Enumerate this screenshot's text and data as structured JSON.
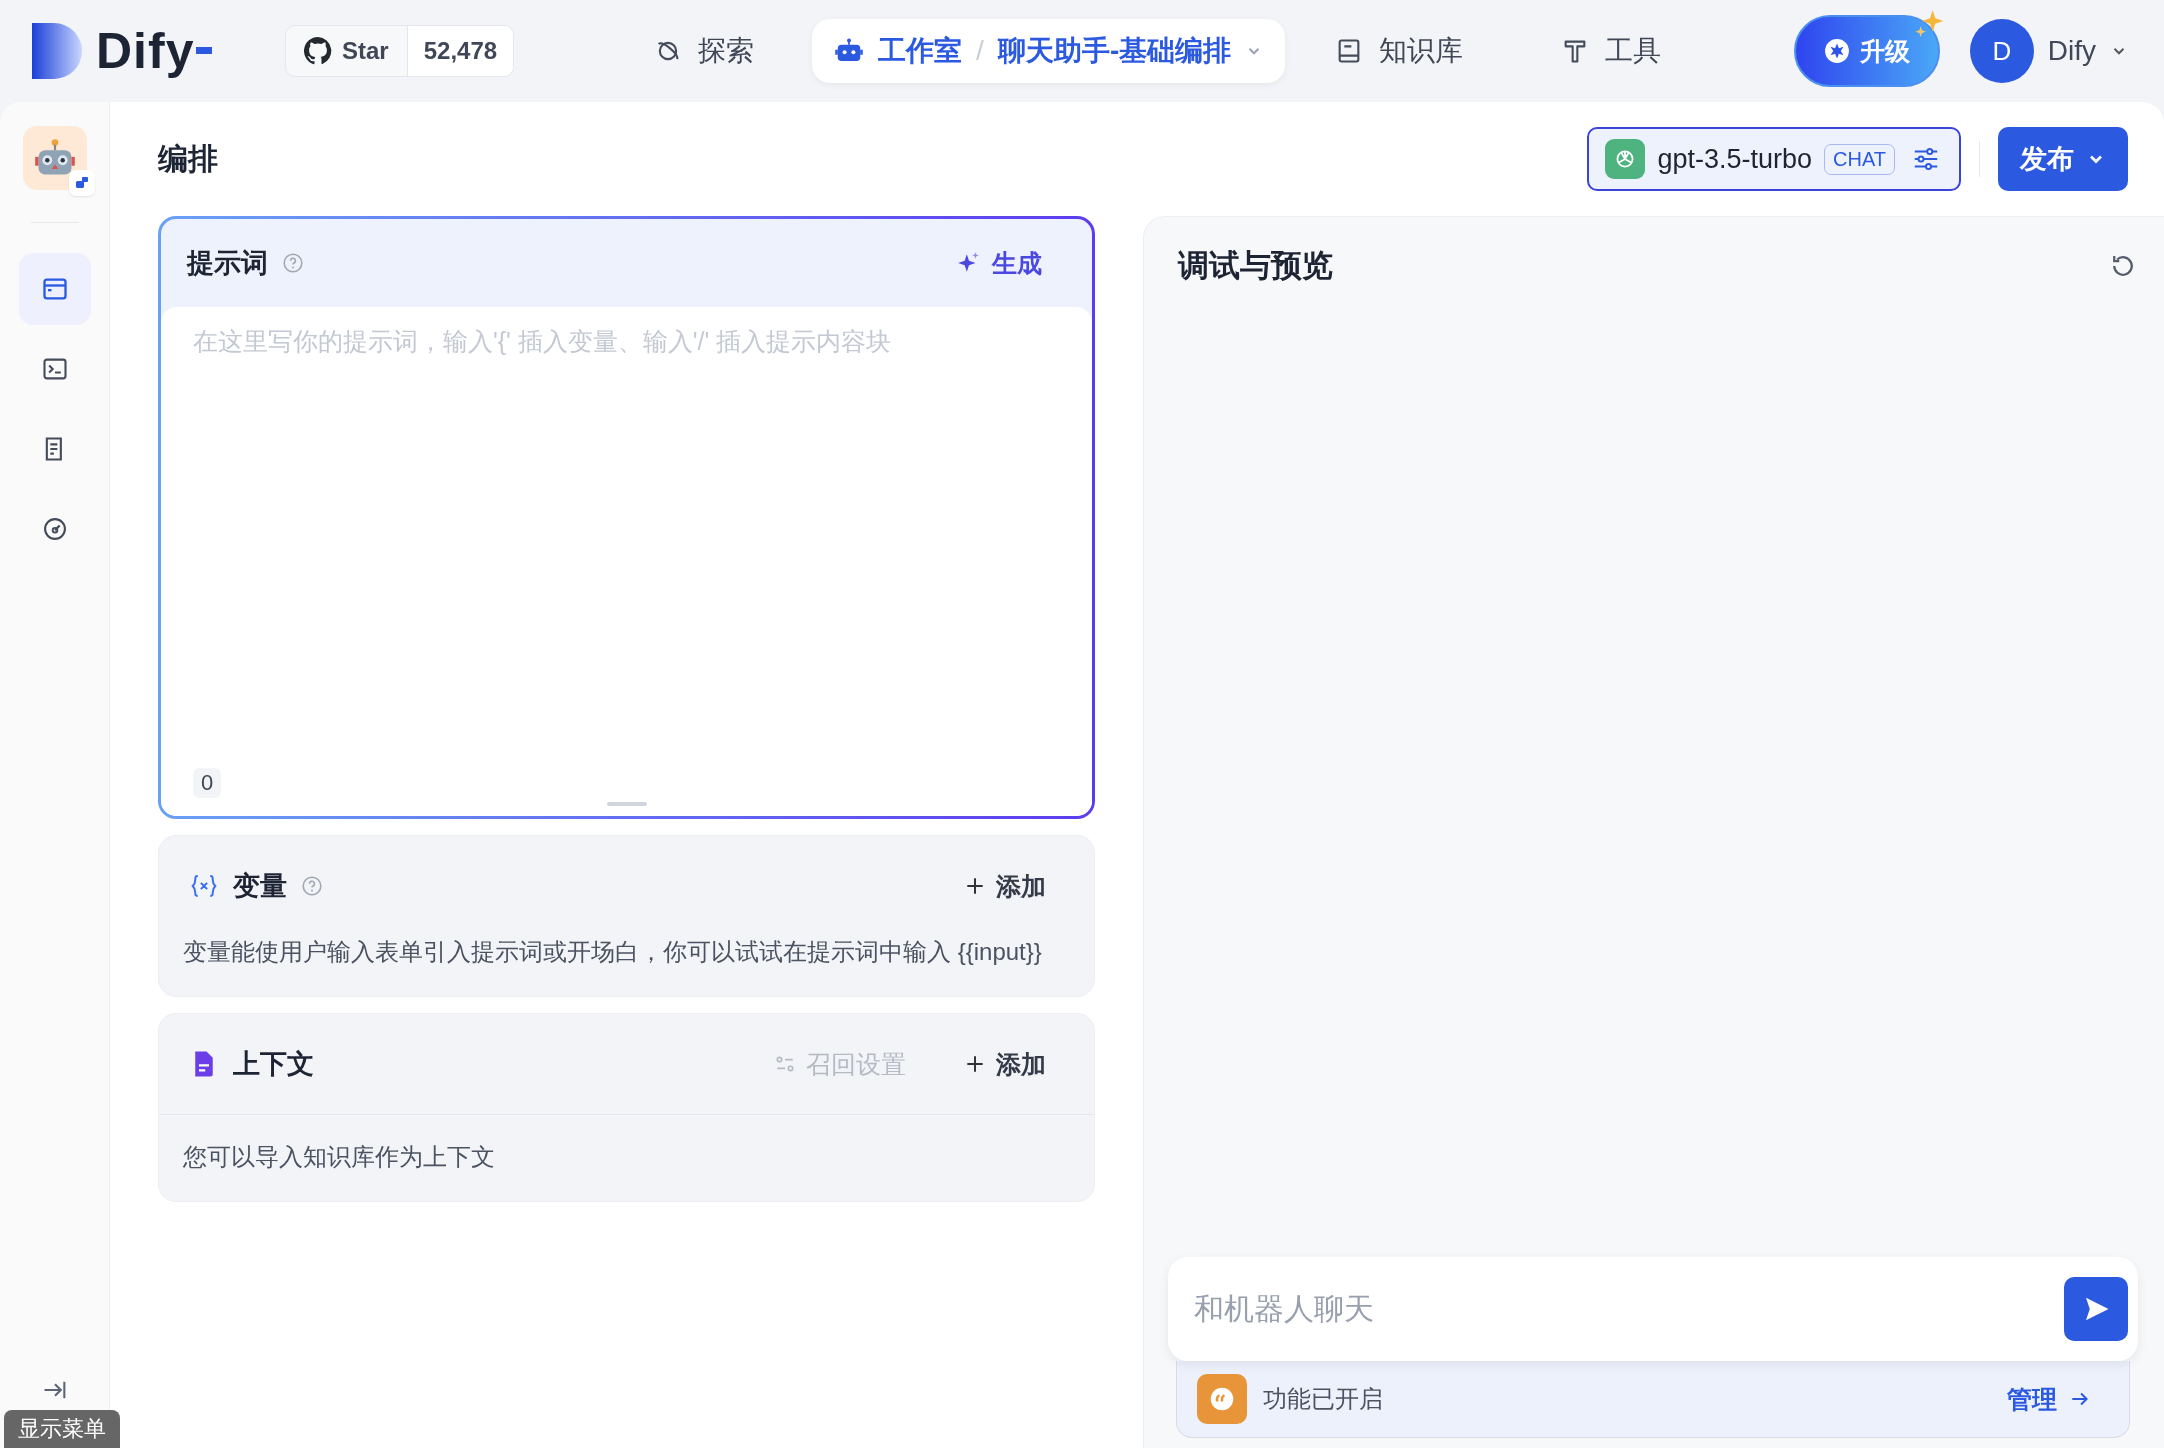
{
  "topbar": {
    "brand": "Dify",
    "github": {
      "label": "Star",
      "count": "52,478"
    },
    "nav": [
      {
        "kind": "explore",
        "label": "探索",
        "selected": false
      },
      {
        "kind": "studio",
        "label": "工作室",
        "separator": "/",
        "app": "聊天助手-基础编排",
        "selected": true
      },
      {
        "kind": "datasets",
        "label": "知识库",
        "selected": false
      },
      {
        "kind": "tools",
        "label": "工具",
        "selected": false
      }
    ],
    "upgrade": "升级",
    "user": {
      "initial": "D",
      "name": "Dify"
    }
  },
  "sidebar": {
    "items": [
      {
        "kind": "orchestrate",
        "selected": true
      },
      {
        "kind": "api",
        "selected": false
      },
      {
        "kind": "logs",
        "selected": false
      },
      {
        "kind": "monitor",
        "selected": false
      }
    ],
    "tooltip": "显示菜单"
  },
  "header": {
    "title": "编排",
    "model": {
      "name": "gpt-3.5-turbo",
      "mode": "CHAT"
    },
    "publish": "发布"
  },
  "prompt": {
    "title": "提示词",
    "generate": "生成",
    "placeholder": "在这里写你的提示词，输入'{' 插入变量、输入'/' 插入提示内容块",
    "count": "0"
  },
  "variables": {
    "title": "变量",
    "add": "添加",
    "description": "变量能使用户输入表单引入提示词或开场白，你可以试试在提示词中输入 {{input}}"
  },
  "context": {
    "title": "上下文",
    "retrieval": {
      "label": "召回设置",
      "disabled": true
    },
    "add": "添加",
    "description": "您可以导入知识库作为上下文"
  },
  "debug": {
    "title": "调试与预览",
    "input": {
      "placeholder": "和机器人聊天"
    },
    "features": {
      "label": "功能已开启",
      "manage": "管理"
    }
  }
}
